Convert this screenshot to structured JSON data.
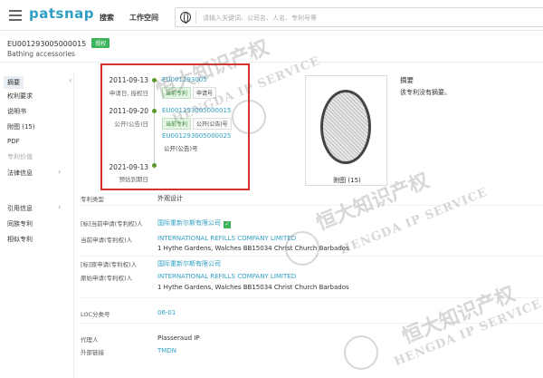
{
  "header": {
    "logo": "patsnap",
    "nav": [
      {
        "label": "搜索"
      },
      {
        "label": "工作空间"
      }
    ],
    "search_placeholder": "请输入关键词、公司名、人名、专利号等"
  },
  "patent": {
    "number": "EU001293005000015",
    "status": "授权",
    "title": "Bathing accessories"
  },
  "sidebar": {
    "items": [
      {
        "label": "摘要"
      },
      {
        "label": "权利要求"
      },
      {
        "label": "说明书"
      },
      {
        "label": "附图 (15)"
      },
      {
        "label": "PDF"
      },
      {
        "label": "专利价值"
      },
      {
        "label": "法律信息"
      },
      {
        "label": "引用信息"
      },
      {
        "label": "同族专利"
      },
      {
        "label": "相似专利"
      }
    ]
  },
  "timeline": [
    {
      "date": "2011-09-13",
      "label": "申请日, 授权日",
      "link": "EU001293005",
      "tags": [
        "当前专利",
        "申请号"
      ]
    },
    {
      "date": "2011-09-20",
      "label": "公开(公告)日",
      "links": [
        "EU001293005000015",
        "EU001293005000025"
      ],
      "tags": [
        "当前专利",
        "公开(公告)号"
      ],
      "tag2": "公开(公告)号"
    },
    {
      "date": "2021-09-13",
      "label": "预估到期日"
    }
  ],
  "drawing": {
    "caption": "附图 (15)"
  },
  "abstract": {
    "title": "摘要",
    "text": "该专利没有摘要。"
  },
  "fields": {
    "patent_type": {
      "label": "专利类型",
      "value": "外观设计"
    },
    "std_current_assignee": {
      "label": "[标]当前申请(专利权)人",
      "value": "国际重新尔斯有限公司"
    },
    "current_assignee": {
      "label": "当前申请(专利权)人",
      "value": "INTERNATIONAL REFILLS COMPANY LIMITED",
      "address": "1 Hythe Gardens, Walches BB15034 Christ Church Barbados"
    },
    "std_original_assignee": {
      "label": "[标]原申请(专利权)人",
      "value": "国际重新尔斯有限公司"
    },
    "original_assignee": {
      "label": "原始申请(专利权)人",
      "value": "INTERNATIONAL REFILLS COMPANY LIMITED",
      "address": "1 Hythe Gardens, Walches BB15034 Christ Church Barbados"
    },
    "loc": {
      "label": "LOC分类号",
      "value": "06-01"
    },
    "agent": {
      "label": "代理人",
      "value": "Plasseraud IP"
    },
    "external_link": {
      "label": "外部链接",
      "value": "TMDN"
    }
  },
  "watermark": {
    "cn": "恒大知识产权",
    "en": "HENGDA IP SERVICE"
  },
  "colors": {
    "accent": "#2f9fc4",
    "green": "#3bb35a",
    "highlight": "#d9302c"
  }
}
